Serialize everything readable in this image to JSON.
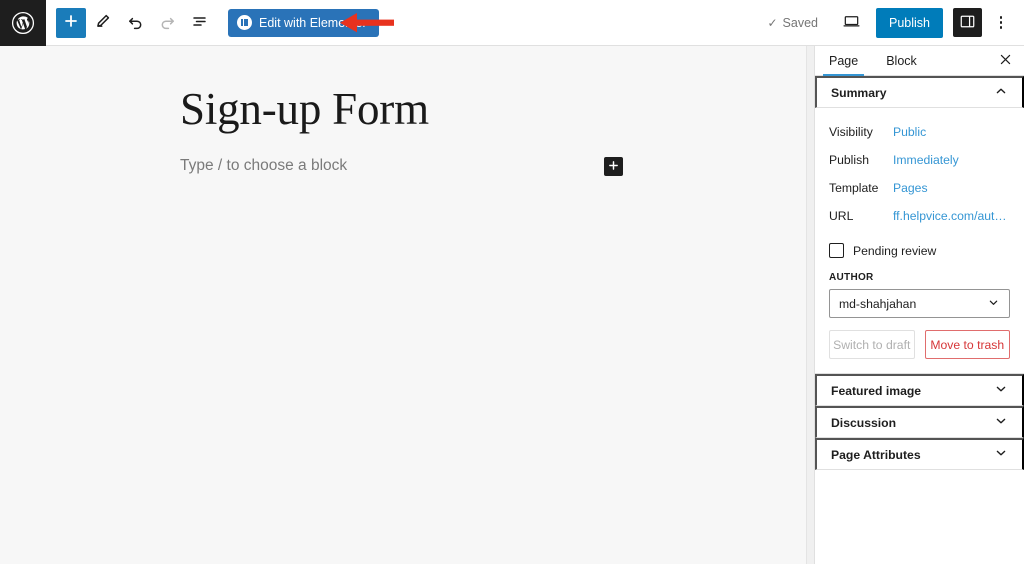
{
  "header": {
    "wp_logo": "wordpress-logo",
    "tools": [
      {
        "name": "add-block-button",
        "label": "Add block",
        "icon": "plus-icon",
        "state": "primary"
      },
      {
        "name": "tools-button",
        "label": "Tools",
        "icon": "pencil-icon",
        "state": "default"
      },
      {
        "name": "undo-button",
        "label": "Undo",
        "icon": "undo-icon",
        "state": "default"
      },
      {
        "name": "redo-button",
        "label": "Redo",
        "icon": "redo-icon",
        "state": "disabled"
      },
      {
        "name": "list-view-button",
        "label": "List View",
        "icon": "list-view-icon",
        "state": "default"
      }
    ],
    "elementor_button": "Edit with Elementor",
    "saved_label": "Saved",
    "saved_check": "✓",
    "preview_label": "Preview",
    "publish_label": "Publish",
    "settings_toggle_label": "Settings",
    "more_menu_label": "Options"
  },
  "annotation": {
    "arrow_color": "#e8321e",
    "arrow_direction": "left",
    "points_to": "Edit with Elementor"
  },
  "canvas": {
    "post_title": "Sign-up Form",
    "block_placeholder": "Type / to choose a block",
    "inserter_label": "Add block",
    "background": "#f7f7f7"
  },
  "sidebar": {
    "tabs": [
      {
        "label": "Page",
        "active": true
      },
      {
        "label": "Block",
        "active": false
      }
    ],
    "close_label": "Close settings",
    "summary": {
      "title": "Summary",
      "rows": [
        {
          "label": "Visibility",
          "value": "Public"
        },
        {
          "label": "Publish",
          "value": "Immediately"
        },
        {
          "label": "Template",
          "value": "Pages"
        },
        {
          "label": "URL",
          "value": "ff.helpvice.com/auto-…"
        }
      ],
      "pending_review": "Pending review",
      "pending_checked": false,
      "author_label": "AUTHOR",
      "author_value": "md-shahjahan",
      "switch_to_draft": "Switch to draft",
      "move_to_trash": "Move to trash"
    },
    "panels": [
      {
        "title": "Featured image"
      },
      {
        "title": "Discussion"
      },
      {
        "title": "Page Attributes"
      }
    ]
  },
  "colors": {
    "accent_blue": "#007cba",
    "link_blue": "#3596d4",
    "elementor_blue": "#2a73b8",
    "danger_red": "#d63638",
    "dark": "#1e1e1e"
  }
}
